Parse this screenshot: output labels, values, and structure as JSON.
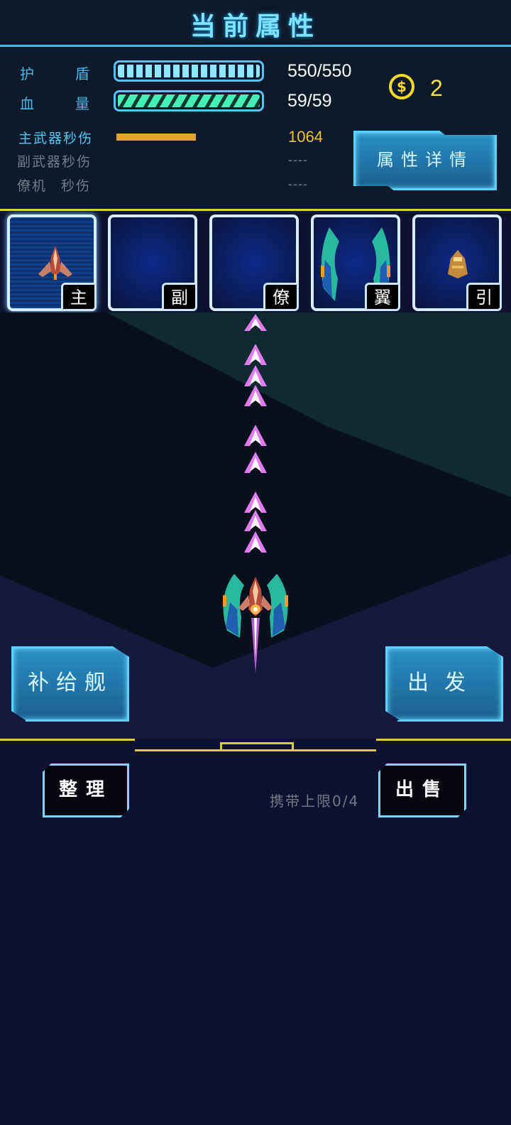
{
  "header": {
    "title": "当前属性"
  },
  "stats": {
    "shield": {
      "label_a": "护",
      "label_b": "盾",
      "value": "550/550",
      "fraction": 1.0
    },
    "hp": {
      "label_a": "血",
      "label_b": "量",
      "value": "59/59",
      "fraction": 1.0
    },
    "main_dps": {
      "label": "主武器秒伤",
      "value": "1064"
    },
    "sub_dps": {
      "label": "副武器秒伤",
      "value": "----"
    },
    "drone_dps": {
      "label_a": "僚机",
      "label_b": "秒伤",
      "value": "----"
    }
  },
  "currency": {
    "icon": "coin-icon",
    "symbol": "$",
    "count": "2"
  },
  "detail_button": {
    "label": "属性详情"
  },
  "slots": [
    {
      "tag": "主",
      "icon": "main-ship-icon",
      "selected": true
    },
    {
      "tag": "副",
      "icon": "",
      "selected": false
    },
    {
      "tag": "僚",
      "icon": "",
      "selected": false
    },
    {
      "tag": "翼",
      "icon": "wings-icon",
      "selected": false
    },
    {
      "tag": "引",
      "icon": "engine-icon",
      "selected": false
    }
  ],
  "battle": {
    "supply_label": "补给舰",
    "depart_label": "出发"
  },
  "inventory": {
    "sort_label": "整理",
    "sell_label": "出售",
    "carry_limit": "携带上限0/4"
  },
  "colors": {
    "accent": "#56d2ff",
    "gold": "#f1c232",
    "hp": "#45f0b8",
    "background": "#0e1230"
  }
}
